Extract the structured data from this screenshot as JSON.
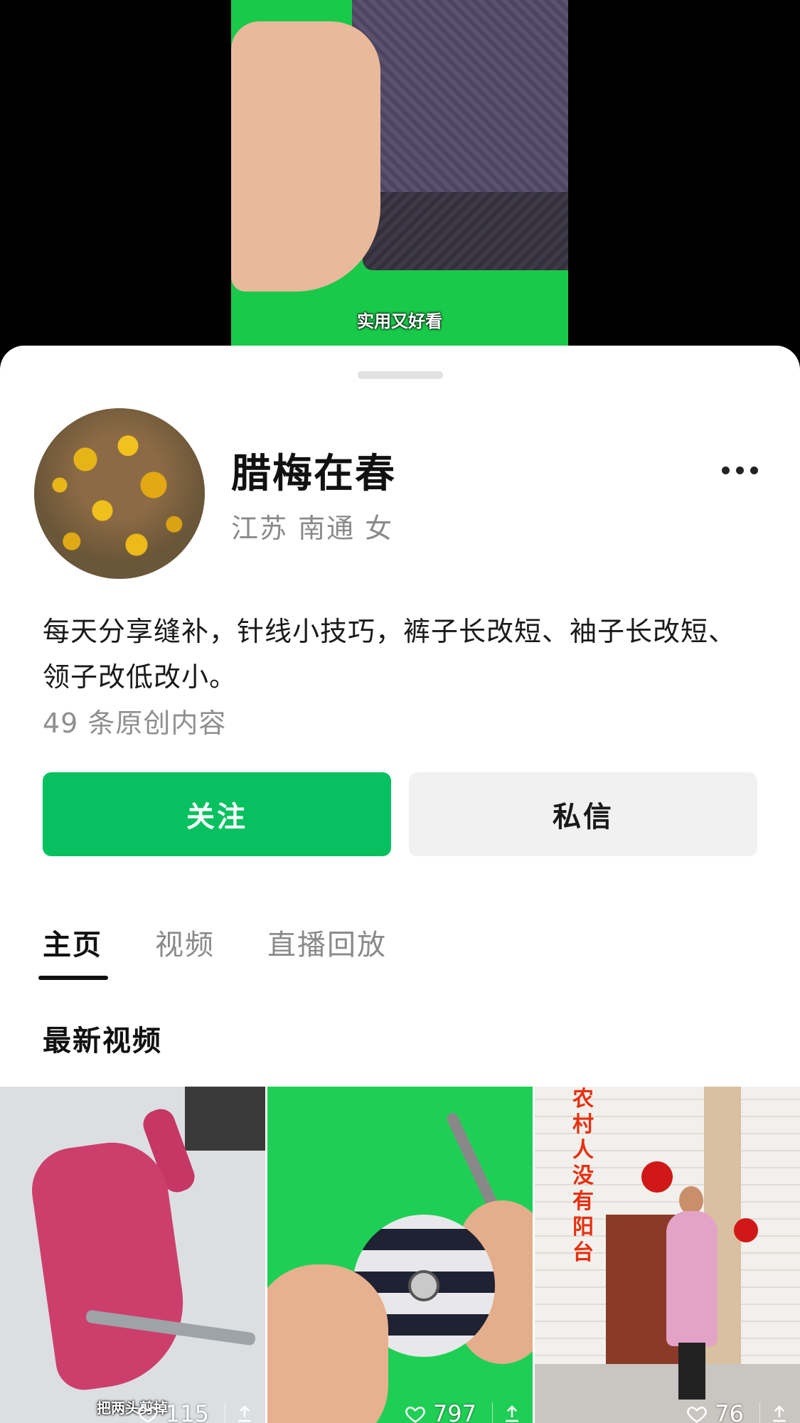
{
  "video": {
    "caption": "实用又好看"
  },
  "profile": {
    "name": "腊梅在春",
    "meta": "江苏 南通 女",
    "bio": "每天分享缝补，针线小技巧，裤子长改短、袖子长改短、领子改低改小。",
    "content_count": "49 条原创内容"
  },
  "actions": {
    "follow_label": "关注",
    "message_label": "私信"
  },
  "tabs": [
    {
      "label": "主页",
      "active": true
    },
    {
      "label": "视频",
      "active": false
    },
    {
      "label": "直播回放",
      "active": false
    }
  ],
  "section_title": "最新视频",
  "videos": [
    {
      "caption": "把两头剪掉",
      "likes": "115"
    },
    {
      "caption": "",
      "likes": "797"
    },
    {
      "overlay_text": "农村人没有阳台",
      "likes": "76"
    }
  ],
  "colors": {
    "accent": "#07c160",
    "green_screen": "#19c94a"
  },
  "icons": [
    "more-icon",
    "heart-icon",
    "share-icon"
  ]
}
